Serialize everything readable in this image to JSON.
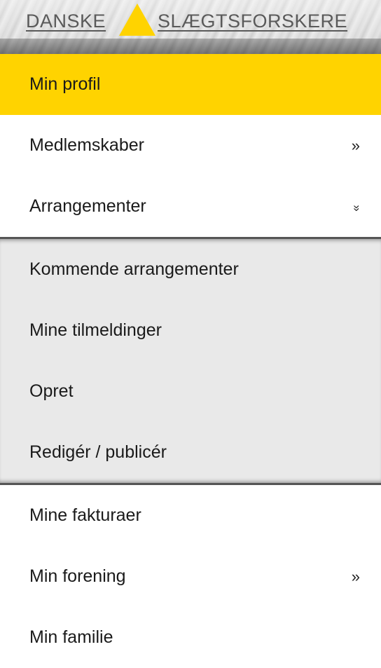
{
  "header": {
    "logo_left": "DANSKE",
    "logo_right": "SLÆGTSFORSKERE",
    "accent_color": "#ffd300"
  },
  "menu": {
    "items": [
      {
        "label": "Min profil",
        "active": true
      },
      {
        "label": "Medlemskaber",
        "icon": "double-chevron-right-icon",
        "glyph": "»"
      },
      {
        "label": "Arrangementer",
        "icon": "double-chevron-down-icon",
        "glyph": "»"
      }
    ],
    "submenu": [
      {
        "label": "Kommende arrangementer"
      },
      {
        "label": "Mine tilmeldinger"
      },
      {
        "label": "Opret"
      },
      {
        "label": "Redigér / publicér"
      }
    ],
    "items_after": [
      {
        "label": "Mine fakturaer"
      },
      {
        "label": "Min forening",
        "icon": "double-chevron-right-icon",
        "glyph": "»"
      },
      {
        "label": "Min familie"
      }
    ]
  }
}
